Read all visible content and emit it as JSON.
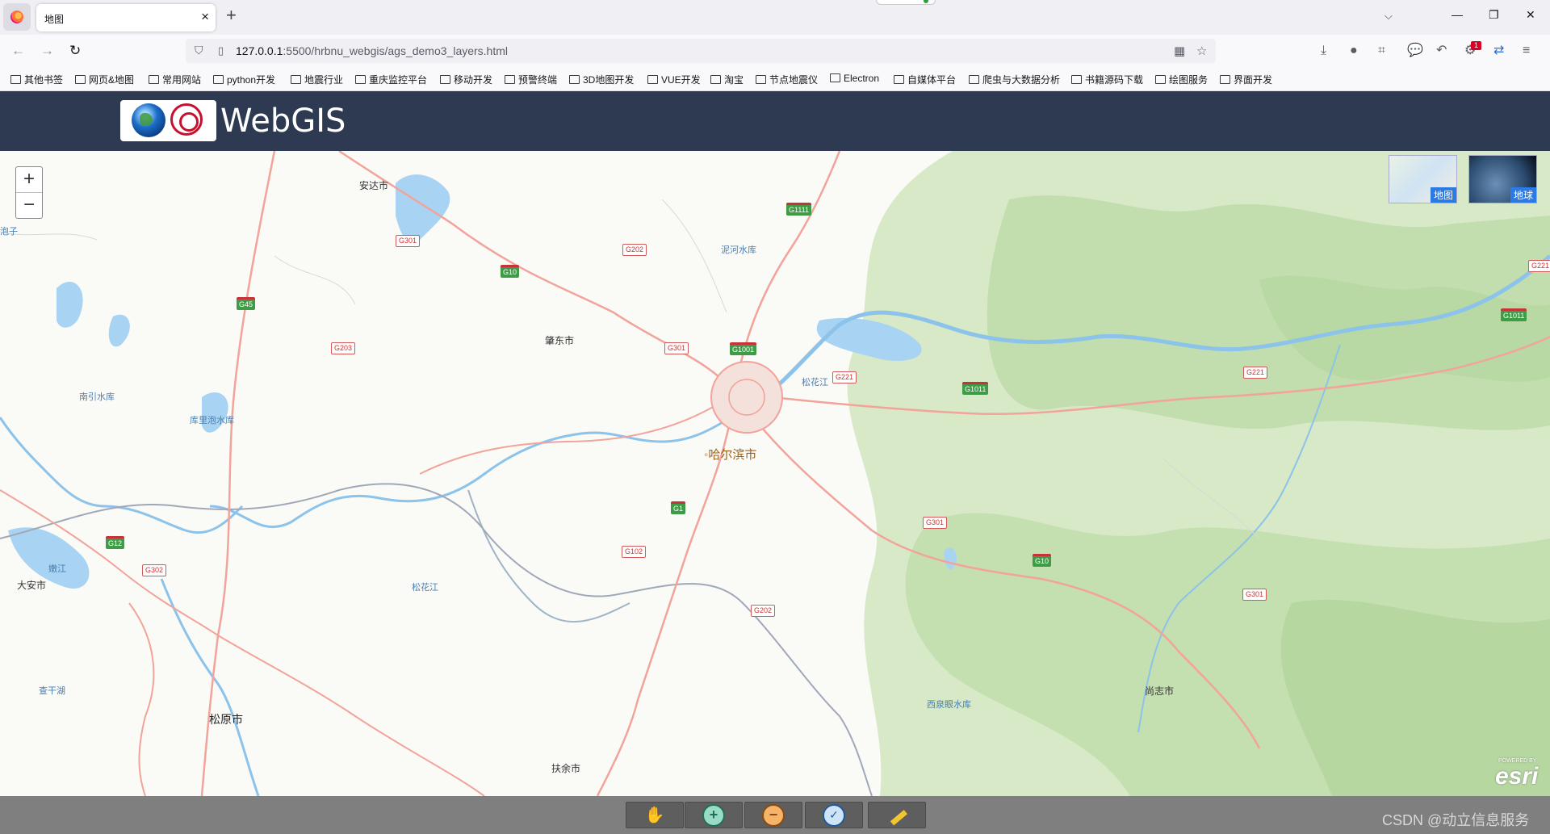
{
  "browser": {
    "tab_title": "地图",
    "tab_close": "×",
    "new_tab": "+",
    "url_host": "127.0.0.1",
    "url_path": ":5500/hrbnu_webgis/ags_demo3_layers.html",
    "badge_count": "1"
  },
  "bookmarks": [
    "其他书签",
    "网页&地图",
    "常用网站",
    "python开发",
    "地震行业",
    "重庆监控平台",
    "移动开发",
    "预警终端",
    "3D地图开发",
    "VUE开发",
    "淘宝",
    "节点地震仪",
    "Electron",
    "自媒体平台",
    "爬虫与大数据分析",
    "书籍源码下载",
    "绘图服务",
    "界面开发"
  ],
  "app": {
    "title": "WebGIS"
  },
  "map": {
    "zoom_in": "+",
    "zoom_out": "−",
    "basemaps": [
      {
        "label": "地图"
      },
      {
        "label": "地球"
      }
    ],
    "places": [
      {
        "name": "安达市",
        "kind": "city"
      },
      {
        "name": "肇东市",
        "kind": "city"
      },
      {
        "name": "哈尔滨市",
        "kind": "capital"
      },
      {
        "name": "大安市",
        "kind": "city"
      },
      {
        "name": "松原市",
        "kind": "city"
      },
      {
        "name": "尚志市",
        "kind": "city"
      },
      {
        "name": "扶余市",
        "kind": "city"
      },
      {
        "name": "泥河水库",
        "kind": "water"
      },
      {
        "name": "松花江",
        "kind": "water"
      },
      {
        "name": "南引水库",
        "kind": "water"
      },
      {
        "name": "库里泡水库",
        "kind": "water"
      },
      {
        "name": "嫩江",
        "kind": "water"
      },
      {
        "name": "松花江",
        "kind": "water"
      },
      {
        "name": "查干湖",
        "kind": "water"
      },
      {
        "name": "西泉眼水库",
        "kind": "water"
      },
      {
        "name": "泡子",
        "kind": "water"
      }
    ],
    "roads": [
      "G301",
      "G202",
      "G10",
      "G1111",
      "G45",
      "G203",
      "G301",
      "G1001",
      "G221",
      "G1011",
      "G221",
      "G221",
      "G1011",
      "G1",
      "G102",
      "G12",
      "G302",
      "G202",
      "G301",
      "G10",
      "G301"
    ],
    "attribution": "esri",
    "attribution_top": "POWERED BY"
  },
  "toolbar": {
    "tools": [
      {
        "name": "pan",
        "icon": "hand-icon"
      },
      {
        "name": "zoom-in",
        "icon": "zoom-in-icon"
      },
      {
        "name": "zoom-out",
        "icon": "zoom-out-icon"
      },
      {
        "name": "full-extent",
        "icon": "full-extent-icon"
      },
      {
        "name": "measure",
        "icon": "ruler-icon"
      }
    ]
  },
  "watermark": "CSDN @动立信息服务"
}
